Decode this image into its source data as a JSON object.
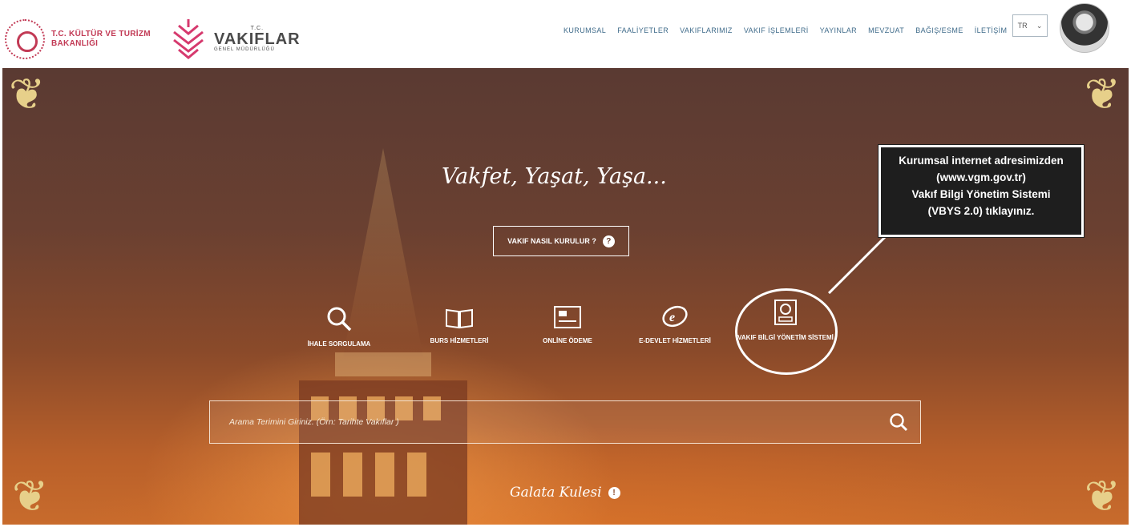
{
  "header": {
    "ministry_line1": "T.C. KÜLTÜR VE TURİZM",
    "ministry_line2": "BAKANLIĞI",
    "vakif_small": "T.C.",
    "vakif_title": "VAKIFLAR",
    "vakif_sub": "GENEL MÜDÜRLÜĞÜ",
    "nav": [
      "KURUMSAL",
      "FAALİYETLER",
      "VAKIFLARIMIZ",
      "VAKIF İŞLEMLERİ",
      "YAYINLAR",
      "MEVZUAT",
      "BAĞIŞ/ESME",
      "İLETİŞİM"
    ],
    "lang": "TR",
    "lang_chevron": "⌄"
  },
  "hero": {
    "slogan": "Vakfet, Yaşat, Yaşa...",
    "how_button": "VAKIF NASIL KURULUR ?",
    "how_icon": "?",
    "services": [
      {
        "label": "İHALE SORGULAMA",
        "icon": "search-icon"
      },
      {
        "label": "BURS HİZMETLERİ",
        "icon": "book-icon"
      },
      {
        "label": "ONLİNE ÖDEME",
        "icon": "card-icon"
      },
      {
        "label": "E-DEVLET HİZMETLERİ",
        "icon": "edevlet-icon"
      },
      {
        "label": "VAKIF BİLGİ YÖNETİM SİSTEMİ",
        "icon": "vbys-icon"
      }
    ],
    "callout_lines": [
      "Kurumsal internet adresimizden",
      "(www.vgm.gov.tr)",
      "Vakıf Bilgi Yönetim Sistemi",
      "(VBYS 2.0)  tıklayınız."
    ],
    "search_placeholder": "Arama Terimini Giriniz. (Örn: Tarihte Vakıflar )",
    "caption": "Galata Kulesi",
    "caption_icon": "!"
  },
  "colors": {
    "ministry_red": "#c23a55",
    "nav_blue": "#3f6b8a",
    "ornament_gold": "#e7d08a",
    "callout_bg": "#1e1e1e"
  }
}
